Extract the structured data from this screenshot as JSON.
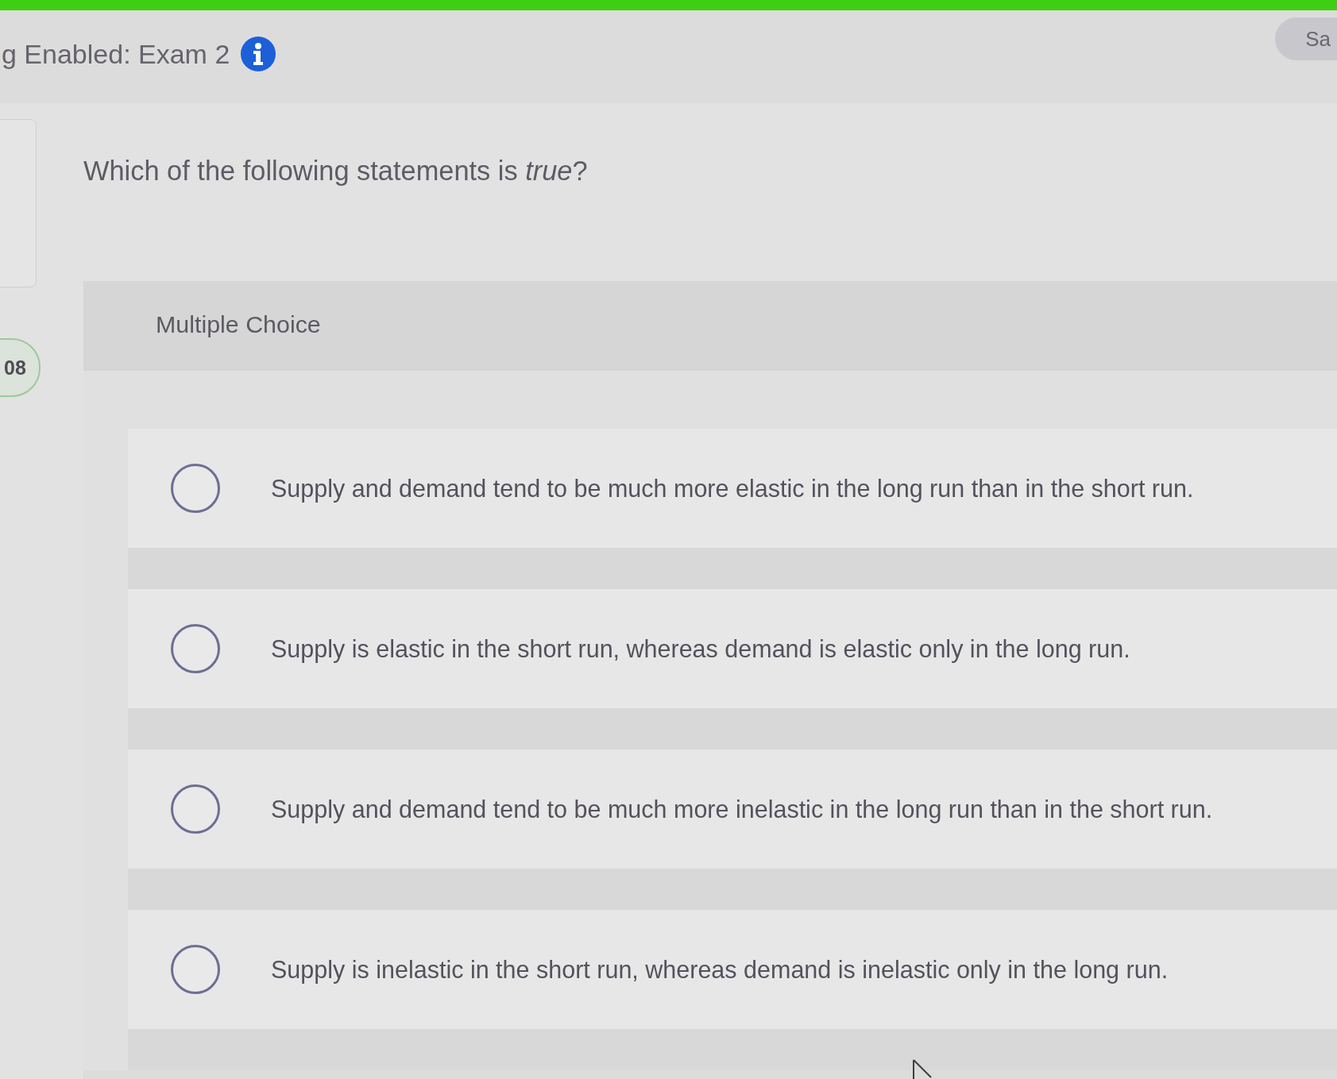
{
  "header": {
    "title": "g Enabled: Exam 2",
    "button": "Sa"
  },
  "timer": {
    "text": "08"
  },
  "question": {
    "text": "Which of the following statements is *true*?"
  },
  "answer_panel": {
    "heading": "Multiple Choice",
    "options": [
      {
        "text": "Supply and demand tend to be much more elastic in the long run than in the short run.",
        "selected": false
      },
      {
        "text": "Supply is elastic in the short run, whereas demand is elastic only in the long run.",
        "selected": false
      },
      {
        "text": "Supply and demand tend to be much more inelastic in the long run than in the short run.",
        "selected": false
      },
      {
        "text": "Supply is inelastic in the short run, whereas demand is inelastic only in the long run.",
        "selected": false
      }
    ]
  }
}
